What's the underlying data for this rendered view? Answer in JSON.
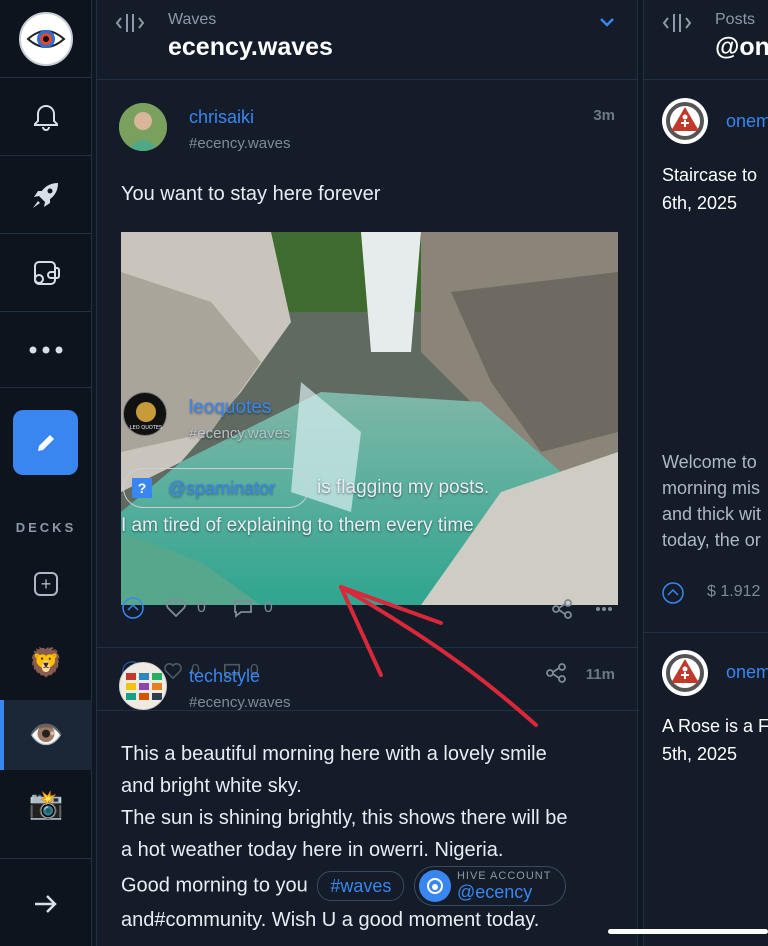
{
  "rail": {
    "icons": [
      "eye-logo-icon",
      "bell-icon",
      "rocket-icon",
      "wallet-icon",
      "more-dots-icon",
      "pencil-icon"
    ],
    "decks_label": "DECKS",
    "deck_emojis": [
      "🦁",
      "👁️",
      "📸"
    ]
  },
  "waves_column": {
    "subtitle": "Waves",
    "title": "ecency.waves",
    "posts": [
      {
        "author": "chrisaiki",
        "community": "#ecency.waves",
        "time": "3m",
        "text": "You want to stay here forever",
        "overlay": {
          "author": "leoquotes",
          "community": "#ecency.waves",
          "mention": "@spaminator",
          "line1": "is flagging my posts.",
          "line2": "I am tired of explaining to them every time"
        },
        "votes": "0",
        "comments": "0"
      },
      {
        "author": "techstyle",
        "community": "#ecency.waves",
        "time": "11m",
        "votes": "0",
        "comments": "0",
        "lines": [
          "This a beautiful morning here with a lovely smile",
          "and bright white sky.",
          "The sun is shining brightly, this shows there will be",
          "a hot weather today here in owerri. Nigeria.",
          "Good morning to you"
        ],
        "tag": "#waves",
        "hive_label": "HIVE ACCOUNT",
        "hive_account": "@ecency",
        "last_line": "and#community. Wish U a good moment today."
      }
    ]
  },
  "posts_column": {
    "subtitle": "Posts",
    "title": "@on",
    "items": [
      {
        "author": "onem",
        "title_lines": [
          "Staircase to",
          "6th, 2025"
        ],
        "excerpt": [
          "Welcome to",
          "morning mis",
          "and thick wit",
          "today, the or"
        ],
        "payout": "$ 1.912"
      },
      {
        "author": "onem",
        "title_lines": [
          "A Rose is a F",
          "5th, 2025"
        ]
      }
    ]
  }
}
